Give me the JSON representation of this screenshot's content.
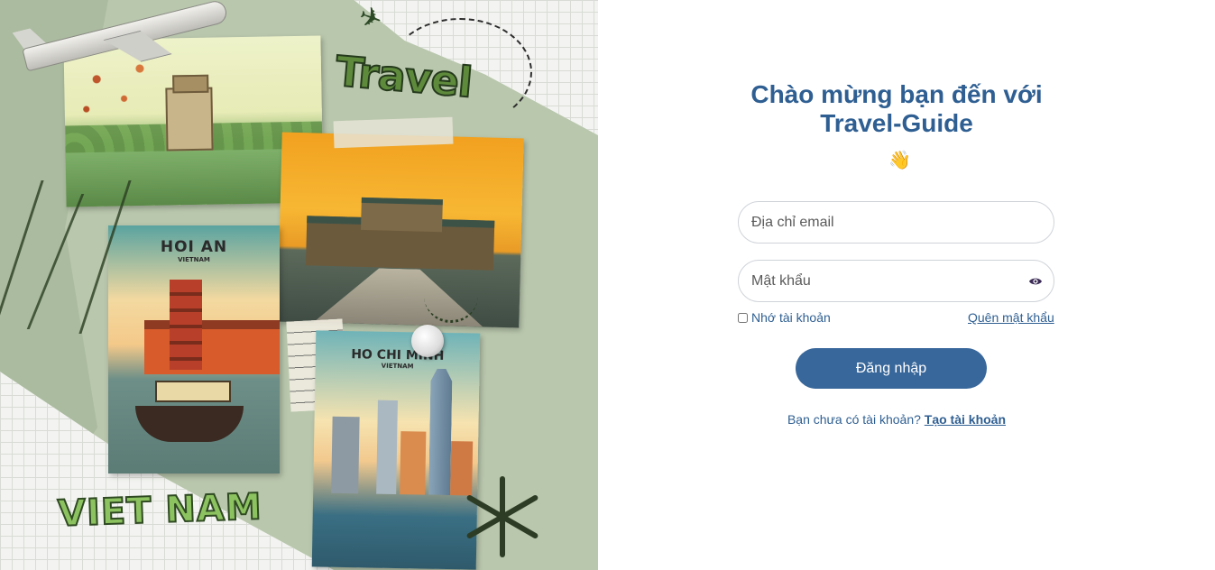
{
  "collage": {
    "travel_label": "Travel",
    "hoian_title": "HOI AN",
    "hoian_subtitle": "VIETNAM",
    "hcm_title": "HO CHI MINH",
    "hcm_subtitle": "VIETNAM",
    "vietnam_label": "VIET NAM"
  },
  "login": {
    "title_line1": "Chào mừng bạn đến với",
    "title_line2": "Travel-Guide",
    "wave_icon": "👋",
    "email_placeholder": "Địa chỉ email",
    "password_placeholder": "Mật khẩu",
    "remember_label": "Nhớ tài khoản",
    "forgot_label": "Quên mật khẩu",
    "login_button": "Đăng nhập",
    "signup_prompt": "Bạn chưa có tài khoản?",
    "signup_link": "Tạo tài khoản"
  },
  "colors": {
    "primary": "#38679b",
    "heading": "#2f5f92"
  }
}
